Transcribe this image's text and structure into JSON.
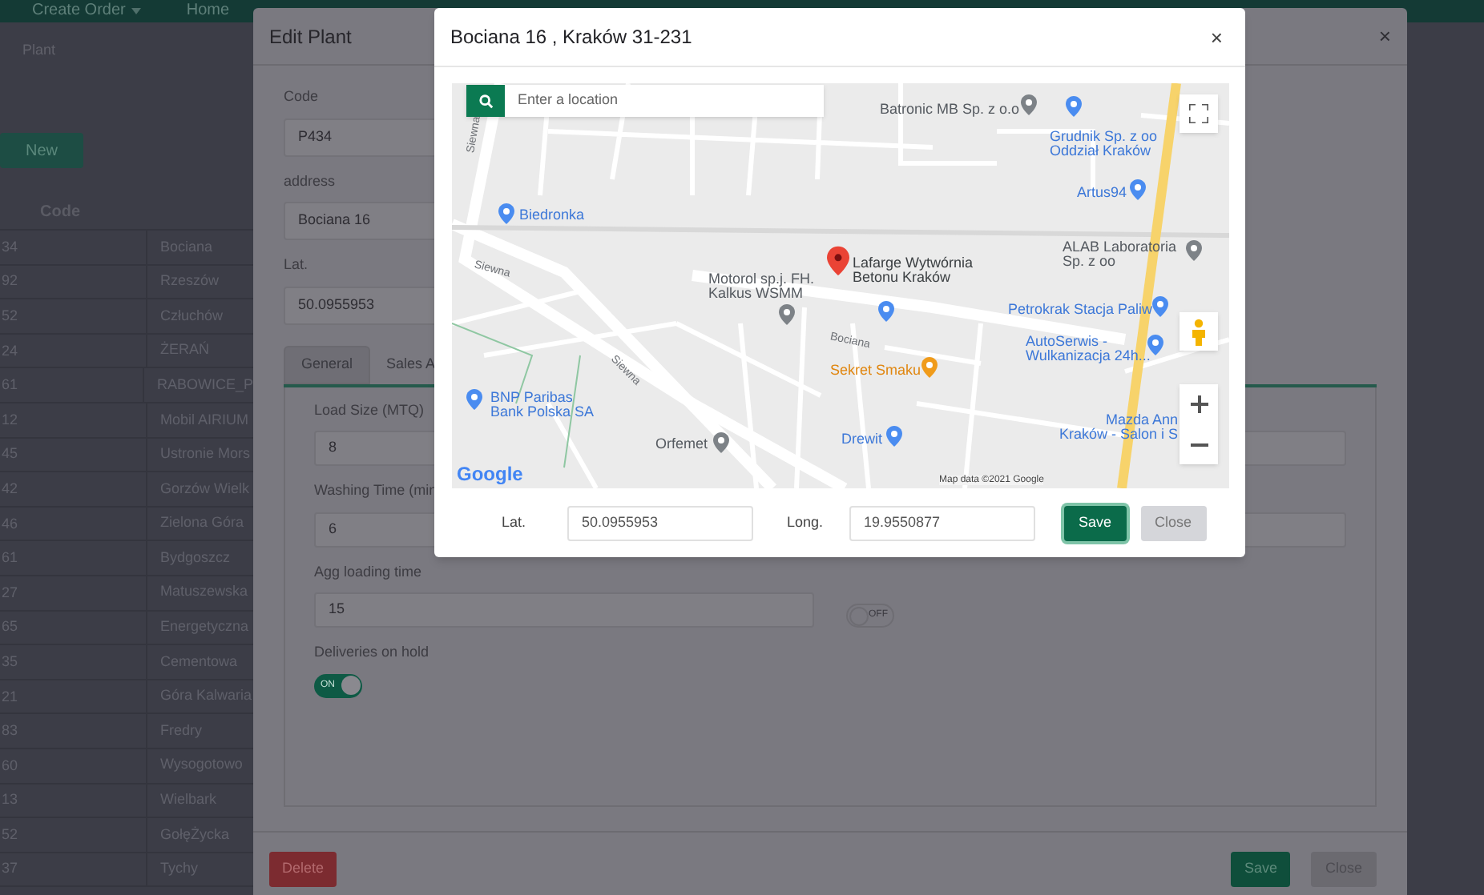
{
  "nav": {
    "items": [
      {
        "label": "Create Order",
        "kind": "dropdown"
      },
      {
        "label": "Home",
        "kind": "link"
      }
    ]
  },
  "breadcrumb": "Plant",
  "new_button": "New",
  "table": {
    "columns": [
      "Code"
    ],
    "rows": [
      {
        "code": "34",
        "name": "Bociana"
      },
      {
        "code": "92",
        "name": "Rzeszów"
      },
      {
        "code": "52",
        "name": "Człuchów"
      },
      {
        "code": "24",
        "name": "ŻERAŃ"
      },
      {
        "code": "61",
        "name": "RABOWICE_P"
      },
      {
        "code": "12",
        "name": "Mobil AIRIUM"
      },
      {
        "code": "45",
        "name": "Ustronie Mors"
      },
      {
        "code": "42",
        "name": "Gorzów Wielk"
      },
      {
        "code": "46",
        "name": "Zielona Góra"
      },
      {
        "code": "61",
        "name": "Bydgoszcz"
      },
      {
        "code": "27",
        "name": "Matuszewska"
      },
      {
        "code": "65",
        "name": "Energetyczna"
      },
      {
        "code": "35",
        "name": "Cementowa"
      },
      {
        "code": "21",
        "name": "Góra Kalwaria"
      },
      {
        "code": "83",
        "name": "Fredry"
      },
      {
        "code": "60",
        "name": "Wysogotowo"
      },
      {
        "code": "13",
        "name": "Wielbark"
      },
      {
        "code": "52",
        "name": "GołęŻycka"
      },
      {
        "code": "37",
        "name": "Tychy"
      }
    ]
  },
  "edit_plant": {
    "title": "Edit Plant",
    "close": "×",
    "fields": [
      {
        "label": "Code",
        "value": "P434"
      },
      {
        "label": "address",
        "value": "Bociana 16"
      },
      {
        "label": "Lat.",
        "value": "50.0955953"
      }
    ],
    "tabs": [
      {
        "label": "General",
        "selected": true
      },
      {
        "label": "Sales A",
        "selected": false
      }
    ],
    "general_fields": [
      {
        "label": "Load Size (MTQ)",
        "value": "8"
      },
      {
        "label": "Washing Time (min",
        "value": "6"
      },
      {
        "label": "Agg loading time",
        "value": "15"
      }
    ],
    "toggles": [
      {
        "label": "Deliveries on hold",
        "on": true,
        "text": "ON"
      },
      {
        "on": false,
        "text": "OFF"
      }
    ],
    "buttons": {
      "delete": "Delete",
      "save": "Save",
      "close": "Close"
    }
  },
  "map_dialog": {
    "title": "Bociana 16 , Kraków 31-231",
    "close": "×",
    "search": {
      "placeholder": "Enter a location"
    },
    "places": [
      {
        "lines": [
          "Batronic MB Sp. z o.o"
        ],
        "kind": "poi"
      },
      {
        "lines": [
          "Grudnik Sp. z oo",
          "Oddział Kraków"
        ],
        "kind": "shop"
      },
      {
        "lines": [
          "Artus94"
        ],
        "kind": "shop"
      },
      {
        "lines": [
          "Biedronka"
        ],
        "kind": "shop"
      },
      {
        "lines": [
          "ALAB Laboratoria",
          "Sp. z oo"
        ],
        "kind": "poi"
      },
      {
        "lines": [
          "Lafarge Wytwórnia",
          "Betonu Kraków"
        ],
        "kind": "selected"
      },
      {
        "lines": [
          "Motorol sp.j. FH.",
          "Kalkus WSMM"
        ],
        "kind": "poi"
      },
      {
        "lines": [
          "Petrokrak Stacja Paliw"
        ],
        "kind": "shop"
      },
      {
        "lines": [
          "AutoSerwis -",
          "Wulkanizacja 24h..."
        ],
        "kind": "shop"
      },
      {
        "lines": [
          "Sekret Smaku"
        ],
        "kind": "food"
      },
      {
        "lines": [
          "BNP Paribas",
          "Bank Polska SA"
        ],
        "kind": "shop"
      },
      {
        "lines": [
          "Drewit"
        ],
        "kind": "shop"
      },
      {
        "lines": [
          "Orfemet"
        ],
        "kind": "poi"
      },
      {
        "lines": [
          "Mazda Ann",
          "Kraków - Salon i S"
        ],
        "kind": "label"
      }
    ],
    "streets": [
      "Siewna",
      "Siewna",
      "Siewna",
      "Bociana"
    ],
    "logo": "Google",
    "attribution": "Map data ©2021 Google",
    "lat": {
      "label": "Lat.",
      "value": "50.0955953"
    },
    "long": {
      "label": "Long.",
      "value": "19.9550877"
    },
    "buttons": {
      "save": "Save",
      "close": "Close"
    }
  }
}
